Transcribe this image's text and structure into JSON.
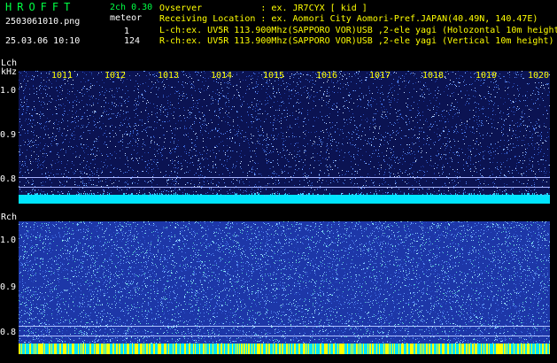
{
  "header": {
    "logo": "HROFFT",
    "version": "2ch 0.30",
    "file_name": "2503061010.png",
    "meteor_label": "meteor",
    "date_time": "25.03.06 10:10",
    "l_count": "1",
    "r_count": "124",
    "info_lines": [
      "Ovserver           : ex. JR7CYX [ kid ]",
      "Receiving Location : ex. Aomori City Aomori-Pref.JAPAN(40.49N, 140.47E)",
      "L-ch:ex. UV5R 113.900Mhz(SAPPORO VOR)USB ,2-ele yagi (Holozontal 10m height",
      "R-ch:ex. UV5R 113.900Mhz(SAPPORO VOR)USB ,2-ele yagi (Vertical 10m height)"
    ]
  },
  "lch": {
    "label": "Lch",
    "unit": "kHz",
    "y_ticks": [
      "1.0",
      "0.9",
      "0.8"
    ],
    "colors": {
      "bg": "#0b1352",
      "band": "#00e5ff"
    }
  },
  "rch": {
    "label": "Rch",
    "y_ticks": [
      "1.0",
      "0.9",
      "0.8"
    ],
    "colors": {
      "bg": "#1d37a8",
      "band": "#00e5ff",
      "burst": "#ffff00"
    }
  },
  "time_ticks": [
    "1011",
    "1012",
    "1013",
    "1014",
    "1015",
    "1016",
    "1017",
    "1018",
    "1019",
    "1020"
  ]
}
